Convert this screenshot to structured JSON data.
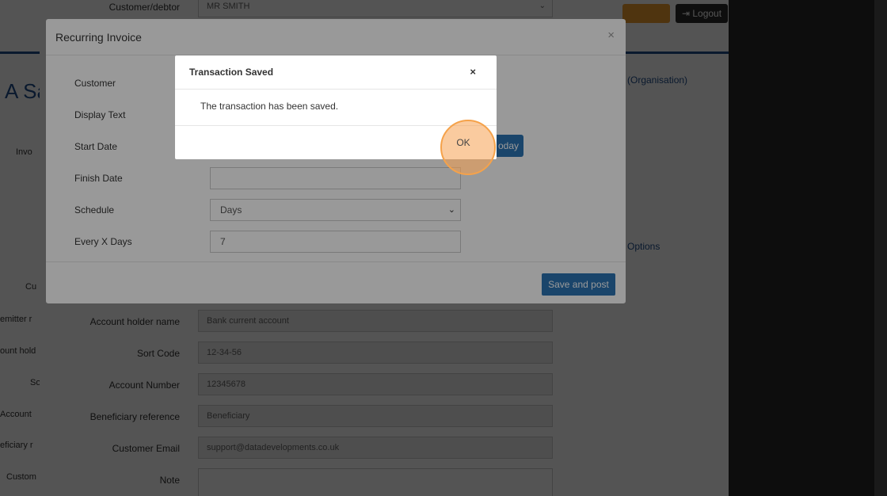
{
  "app": {
    "logout_label": "Logout",
    "nav_items": [
      "",
      ""
    ],
    "page_title_fragment": "A Sa",
    "org_link": "(Organisation)",
    "heading_fragment": "Options",
    "side_labels": [
      "Invo",
      "Cu",
      "emitter r",
      "ount hold",
      "So",
      "Account",
      "eficiary r",
      "Custom"
    ]
  },
  "form_page": {
    "rows": [
      {
        "label": "Customer/debtor",
        "value": "MR SMITH"
      },
      {
        "label": "Account holder name",
        "value": "Bank current account"
      },
      {
        "label": "Sort Code",
        "value": "12-34-56"
      },
      {
        "label": "Account Number",
        "value": "12345678"
      },
      {
        "label": "Beneficiary reference",
        "value": "Beneficiary"
      },
      {
        "label": "Customer Email",
        "value": "support@datadevelopments.co.uk"
      },
      {
        "label": "Note",
        "value": ""
      }
    ]
  },
  "recurring_modal": {
    "title": "Recurring Invoice",
    "close_glyph": "×",
    "fields": [
      {
        "label": "Customer",
        "value": ""
      },
      {
        "label": "Display Text",
        "value": ""
      },
      {
        "label": "Start Date",
        "value": ""
      },
      {
        "label": "Finish Date",
        "value": ""
      },
      {
        "label": "Schedule",
        "value": "Days"
      },
      {
        "label": "Every X Days",
        "value": "7"
      }
    ],
    "today_label": "oday",
    "save_post_label": "Save and post"
  },
  "saved_modal": {
    "title": "Transaction Saved",
    "close_glyph": "×",
    "message": "The transaction has been saved.",
    "ok_label": "OK"
  },
  "colors": {
    "primary": "#2c74b3",
    "nav_blue": "#1f4e8c",
    "highlight": "#f5a24a"
  }
}
